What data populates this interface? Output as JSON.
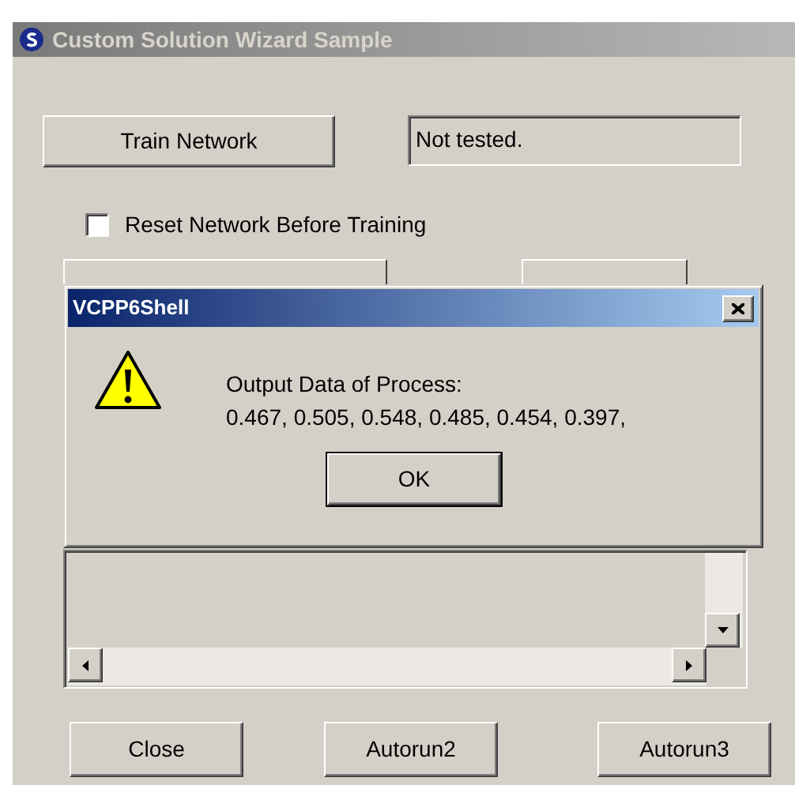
{
  "window": {
    "title": "Custom Solution Wizard Sample"
  },
  "train_button": {
    "label": "Train Network"
  },
  "status_field": {
    "value": "Not tested."
  },
  "reset_checkbox": {
    "label": "Reset Network Before Training",
    "checked": false
  },
  "message_box": {
    "title": "VCPP6Shell",
    "lines": [
      "Output Data of Process:",
      "0.467, 0.505, 0.548, 0.485, 0.454, 0.397,"
    ],
    "button": "OK"
  },
  "buttons": [
    {
      "label": "Close"
    },
    {
      "label": "Autorun2"
    },
    {
      "label": "Autorun3"
    }
  ]
}
